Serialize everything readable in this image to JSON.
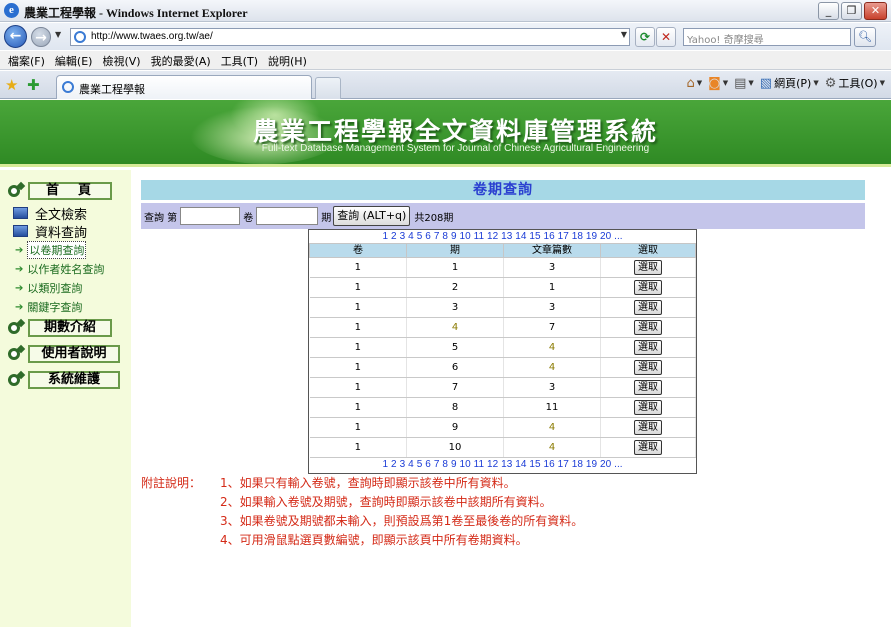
{
  "window": {
    "title": "農業工程學報 - Windows Internet Explorer"
  },
  "browser": {
    "url": "http://www.twaes.org.tw/ae/",
    "search_placeholder": "Yahoo! 奇摩搜尋",
    "menu": [
      "檔案(F)",
      "編輯(E)",
      "檢視(V)",
      "我的最愛(A)",
      "工具(T)",
      "說明(H)"
    ],
    "tab_title": "農業工程學報",
    "commands": {
      "page": "網頁(P)",
      "tools": "工具(O)"
    }
  },
  "banner": {
    "title": "農業工程學報全文資料庫管理系統",
    "subtitle": "Full-text Database Management System for Journal of Chinese Agricultural Engineering"
  },
  "sidebar": {
    "home": "首　頁",
    "fulltext": "全文檢索",
    "dataquery": "資料查詢",
    "links": [
      "以卷期查詢",
      "以作者姓名查詢",
      "以類別查詢",
      "關鍵字查詢"
    ],
    "issues": "期數介紹",
    "userguide": "使用者說明",
    "maintenance": "系統維護"
  },
  "main": {
    "heading": "卷期查詢",
    "query": {
      "label_query": "查詢 第",
      "label_volume": "卷",
      "label_issue": "期",
      "button": "查詢 (ALT+q)",
      "total": "共208期"
    },
    "pager": [
      "1",
      "2",
      "3",
      "4",
      "5",
      "6",
      "7",
      "8",
      "9",
      "10",
      "11",
      "12",
      "13",
      "14",
      "15",
      "16",
      "17",
      "18",
      "19",
      "20",
      "..."
    ],
    "columns": [
      "卷",
      "期",
      "文章篇數",
      "選取"
    ],
    "select_label": "選取",
    "rows": [
      {
        "vol": "1",
        "issue": "1",
        "count": "3"
      },
      {
        "vol": "1",
        "issue": "2",
        "count": "1"
      },
      {
        "vol": "1",
        "issue": "3",
        "count": "3"
      },
      {
        "vol": "1",
        "issue": "4",
        "count": "7"
      },
      {
        "vol": "1",
        "issue": "5",
        "count": "4"
      },
      {
        "vol": "1",
        "issue": "6",
        "count": "4"
      },
      {
        "vol": "1",
        "issue": "7",
        "count": "3"
      },
      {
        "vol": "1",
        "issue": "8",
        "count": "11"
      },
      {
        "vol": "1",
        "issue": "9",
        "count": "4"
      },
      {
        "vol": "1",
        "issue": "10",
        "count": "4"
      }
    ],
    "notes": {
      "heading": "附註說明：",
      "items": [
        "1、如果只有輸入卷號，查詢時即顯示該卷中所有資料。",
        "2、如果輸入卷號及期號，查詢時即顯示該卷中該期所有資料。",
        "3、如果卷號及期號都未輸入，則預設爲第1卷至最後卷的所有資料。",
        "4、可用滑鼠點選頁數編號，即顯示該頁中所有卷期資料。"
      ]
    }
  }
}
